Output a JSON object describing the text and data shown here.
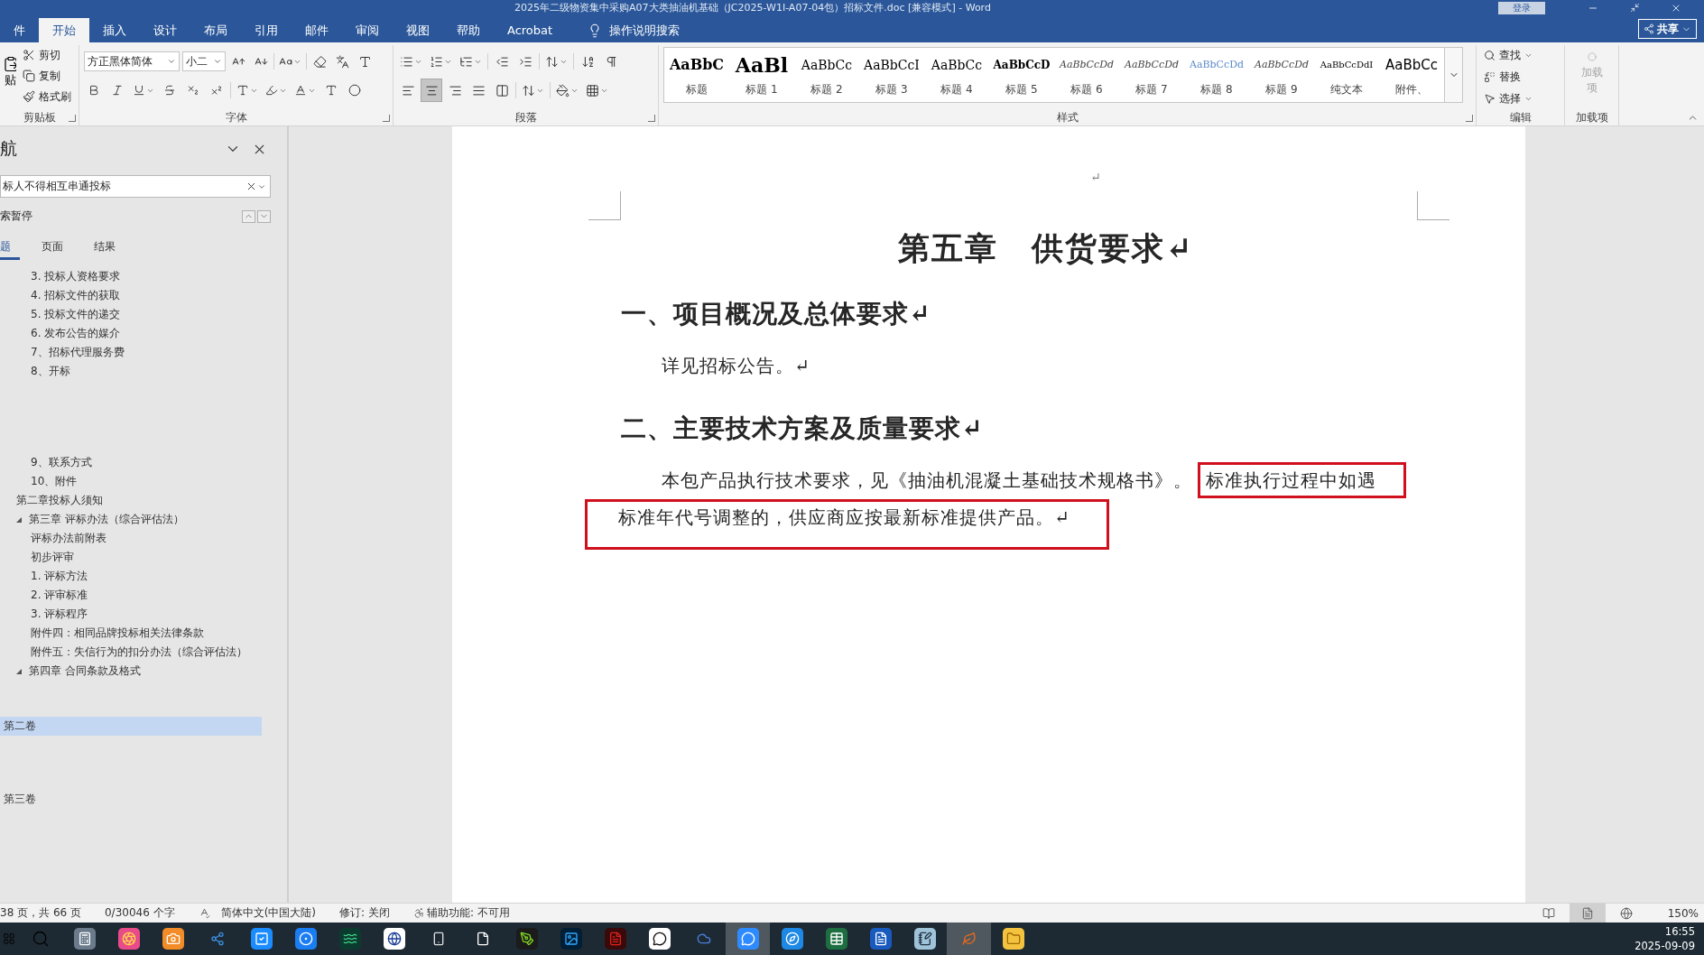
{
  "window": {
    "title": "2025年二级物资集中采购A07大类抽油机基础（JC2025-W1I-A07-04包）招标文件.doc [兼容模式] - Word",
    "sign_in": "登录"
  },
  "ribbon_tabs": [
    {
      "label": "件",
      "selected": false
    },
    {
      "label": "开始",
      "selected": true
    },
    {
      "label": "插入",
      "selected": false
    },
    {
      "label": "设计",
      "selected": false
    },
    {
      "label": "布局",
      "selected": false
    },
    {
      "label": "引用",
      "selected": false
    },
    {
      "label": "邮件",
      "selected": false
    },
    {
      "label": "审阅",
      "selected": false
    },
    {
      "label": "视图",
      "selected": false
    },
    {
      "label": "帮助",
      "selected": false
    },
    {
      "label": "Acrobat",
      "selected": false
    }
  ],
  "tell_me": "操作说明搜索",
  "share": "共享",
  "clipboard": {
    "paste": "贴",
    "cut": "剪切",
    "copy": "复制",
    "format_painter": "格式刷",
    "label": "剪贴板"
  },
  "font": {
    "name": "方正黑体简体",
    "size": "小二",
    "label": "字体"
  },
  "paragraph": {
    "alignments": [
      {
        "kind": "left",
        "selected": false
      },
      {
        "kind": "center",
        "selected": true
      },
      {
        "kind": "right",
        "selected": false
      },
      {
        "kind": "justify",
        "selected": false
      },
      {
        "kind": "distributed",
        "selected": false
      }
    ],
    "label": "段落"
  },
  "styles": {
    "label": "样式",
    "items": [
      {
        "sample": "AaBbC",
        "label": "标题",
        "kind": "title"
      },
      {
        "sample": "AaBl",
        "label": "标题 1",
        "kind": "large"
      },
      {
        "sample": "AaBbCc",
        "label": "标题 2",
        "kind": "plain"
      },
      {
        "sample": "AaBbCcI",
        "label": "标题 3",
        "kind": "plain"
      },
      {
        "sample": "AaBbCc",
        "label": "标题 4",
        "kind": "plain"
      },
      {
        "sample": "AaBbCcD",
        "label": "标题 5",
        "kind": "bold"
      },
      {
        "sample": "AaBbCcDd",
        "label": "标题 6",
        "kind": "italic"
      },
      {
        "sample": "AaBbCcDd",
        "label": "标题 7",
        "kind": "italic"
      },
      {
        "sample": "AaBbCcDd",
        "label": "标题 8",
        "kind": "accent"
      },
      {
        "sample": "AaBbCcDd",
        "label": "标题 9",
        "kind": "italic"
      },
      {
        "sample": "AaBbCcDdI",
        "label": "纯文本",
        "kind": "small"
      },
      {
        "sample": "AaBbCc",
        "label": "附件、",
        "kind": "sans"
      }
    ]
  },
  "editing": {
    "find": "查找",
    "replace": "替换",
    "select": "选择",
    "label": "编辑"
  },
  "addins": {
    "button": "加载项",
    "label": "加载项",
    "disabled": true
  },
  "nav": {
    "title": "航",
    "search": "标人不得相互串通投标",
    "status": "索暂停",
    "tabs": [
      {
        "label": "题",
        "selected": true
      },
      {
        "label": "页面",
        "selected": false
      },
      {
        "label": "结果",
        "selected": false
      }
    ],
    "outline": [
      {
        "children": [
          {
            "label": "3. 投标人资格要求"
          },
          {
            "label": "4. 招标文件的获取"
          },
          {
            "label": "5. 投标文件的递交"
          },
          {
            "label": "6. 发布公告的媒介"
          },
          {
            "label": "7、招标代理服务费"
          },
          {
            "label": "8、开标"
          },
          {
            "label": "9、联系方式"
          },
          {
            "label": "10、附件"
          }
        ]
      },
      {
        "label": "第二章投标人须知"
      },
      {
        "label": "第三章  评标办法（综合评估法）",
        "expanded": true,
        "children": [
          {
            "label": "评标办法前附表"
          },
          {
            "label": "初步评审"
          },
          {
            "label": "1. 评标方法"
          },
          {
            "label": "2. 评审标准"
          },
          {
            "label": "3. 评标程序"
          },
          {
            "label": "附件四：相同品牌投标相关法律条款"
          },
          {
            "label": "附件五：失信行为的扣分办法（综合评估法）"
          }
        ]
      },
      {
        "label": "第四章  合同条款及格式",
        "expanded": true
      }
    ],
    "volumes": [
      {
        "label": "第二卷",
        "selected": true
      },
      {
        "label": "第三卷",
        "selected": false
      }
    ]
  },
  "document": {
    "blank_mark": "↵",
    "title": "第五章　供货要求↵",
    "sections": [
      {
        "heading": "一、项目概况及总体要求↵",
        "paragraphs": [
          {
            "text": "详见招标公告。↵"
          }
        ]
      },
      {
        "heading": "二、主要技术方案及质量要求↵",
        "paragraphs": [
          {
            "text": "本包产品执行技术要求，见《抽油机混凝土基础技术规格书》。",
            "highlight": [
              "标准执行过程中如遇",
              "标准年代号调整的，供应商应按最新标准提供产品。↵"
            ]
          }
        ]
      }
    ]
  },
  "status_bar": {
    "page": "38 页，共 66 页",
    "words": "0/30046 个字",
    "language": "简体中文(中国大陆)",
    "track_changes": "修订: 关闭",
    "accessibility": "辅助功能: 不可用",
    "views": [
      {
        "kind": "read",
        "selected": false
      },
      {
        "kind": "print",
        "selected": true
      },
      {
        "kind": "web",
        "selected": false
      }
    ],
    "zoom": "150%"
  },
  "taskbar": {
    "apps": [
      {
        "kind": "calculator",
        "active": false
      },
      {
        "kind": "aperture",
        "active": false
      },
      {
        "kind": "camera",
        "active": false
      },
      {
        "kind": "dots",
        "active": false
      },
      {
        "kind": "check",
        "active": false
      },
      {
        "kind": "circle",
        "active": false
      },
      {
        "kind": "waves",
        "active": false
      },
      {
        "kind": "globe",
        "active": false
      },
      {
        "kind": "phone",
        "active": false
      },
      {
        "kind": "file",
        "active": false
      },
      {
        "kind": "pen",
        "active": false
      },
      {
        "kind": "image",
        "active": false
      },
      {
        "kind": "pdf",
        "active": false
      },
      {
        "kind": "chat",
        "active": false
      },
      {
        "kind": "cloud",
        "active": false
      },
      {
        "kind": "message",
        "active": true
      },
      {
        "kind": "compass",
        "active": false
      },
      {
        "kind": "sheet",
        "active": false
      },
      {
        "kind": "doc",
        "active": false
      },
      {
        "kind": "notepad",
        "active": false
      },
      {
        "kind": "leaf",
        "active": true
      },
      {
        "kind": "folder",
        "active": false
      }
    ],
    "time": "16:55",
    "date": "2025-09-09"
  }
}
